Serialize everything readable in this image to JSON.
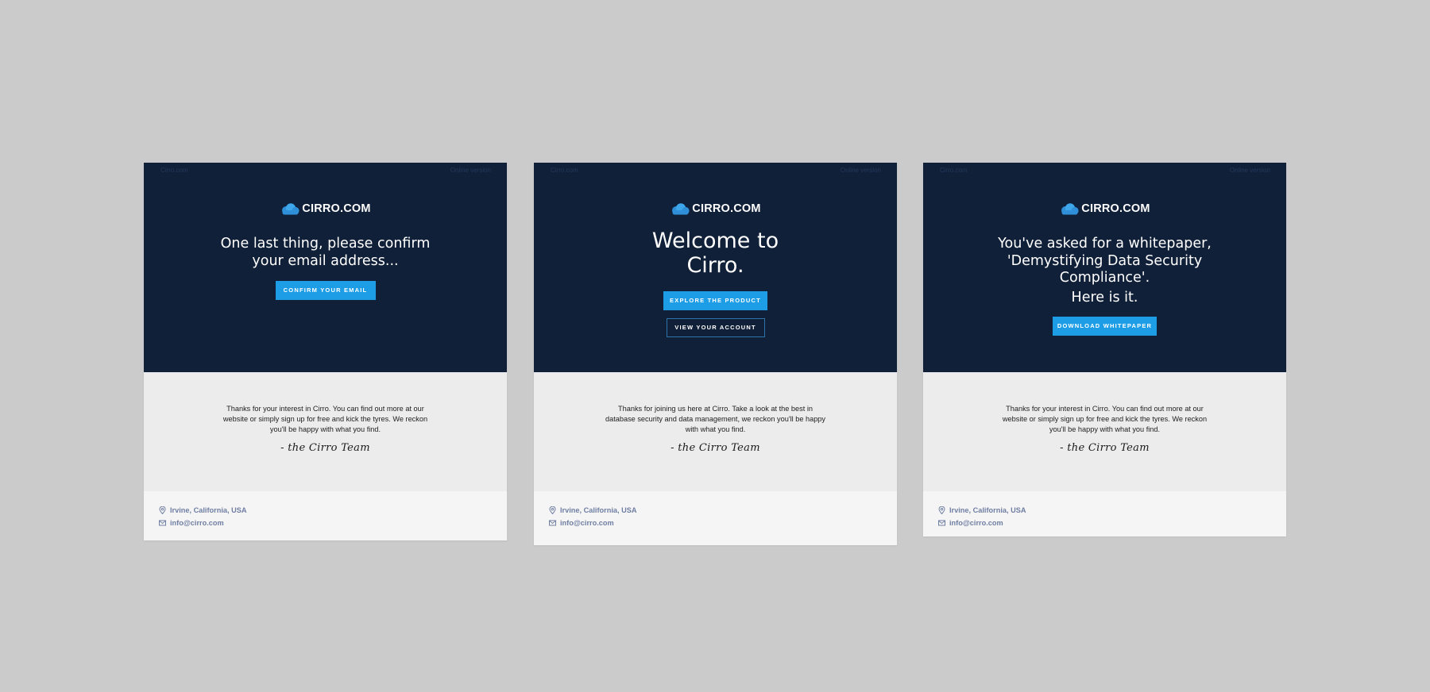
{
  "colors": {
    "background": "#cbcbcb",
    "hero": "#112039",
    "accent": "#1d9de6",
    "body": "#ececec",
    "footer": "#f5f5f5",
    "footer_text": "#6f7ea3"
  },
  "cards": [
    {
      "topbar": {
        "left": "Cirro.com",
        "right": "Online version"
      },
      "logo": "CIRRO.COM",
      "headline": "One last thing, please confirm your email address...",
      "primary_button": "CONFIRM YOUR EMAIL",
      "body_text": "Thanks for your interest in Cirro. You can find out more at our website or simply sign up for free and kick the tyres. We reckon you'll be happy with what you find.",
      "signature": "- the Cirro Team",
      "footer": {
        "location": "Irvine, California, USA",
        "email": "info@cirro.com"
      }
    },
    {
      "topbar": {
        "left": "Cirro.com",
        "right": "Online version"
      },
      "logo": "CIRRO.COM",
      "headline": "Welcome to Cirro.",
      "primary_button": "EXPLORE THE PRODUCT",
      "secondary_button": "VIEW YOUR ACCOUNT",
      "body_text": "Thanks for joining us here at Cirro. Take a look at the best in database security and data management, we reckon you'll be happy with what you find.",
      "signature": "- the Cirro Team",
      "footer": {
        "location": "Irvine, California, USA",
        "email": "info@cirro.com"
      }
    },
    {
      "topbar": {
        "left": "Cirro.com",
        "right": "Online version"
      },
      "logo": "CIRRO.COM",
      "headline": "You've asked for a whitepaper, 'Demystifying Data Security Compliance'.",
      "headline_2": "Here is it.",
      "primary_button": "DOWNLOAD WHITEPAPER",
      "body_text": "Thanks for your interest in Cirro. You can find out more at our website or simply sign up for free and kick the tyres. We reckon you'll be happy with what you find.",
      "signature": "- the Cirro Team",
      "footer": {
        "location": "Irvine, California, USA",
        "email": "info@cirro.com"
      }
    }
  ]
}
